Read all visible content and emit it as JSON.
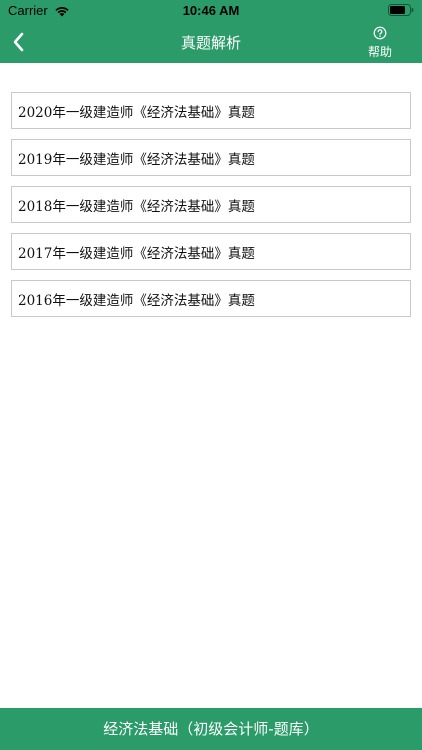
{
  "status_bar": {
    "carrier": "Carrier",
    "time": "10:46 AM"
  },
  "nav": {
    "title": "真题解析",
    "help_label": "帮助",
    "back_icon": "chevron-left-icon",
    "help_icon": "question-circle-icon"
  },
  "list": {
    "items": [
      {
        "label": "2020年一级建造师《经济法基础》真题"
      },
      {
        "label": "2019年一级建造师《经济法基础》真题"
      },
      {
        "label": "2018年一级建造师《经济法基础》真题"
      },
      {
        "label": "2017年一级建造师《经济法基础》真题"
      },
      {
        "label": "2016年一级建造师《经济法基础》真题"
      }
    ]
  },
  "bottom_bar": {
    "label": "经济法基础（初级会计师-题库）"
  },
  "colors": {
    "accent": "#2b9b6a",
    "item_border": "#c9c9c9",
    "text": "#111111"
  }
}
